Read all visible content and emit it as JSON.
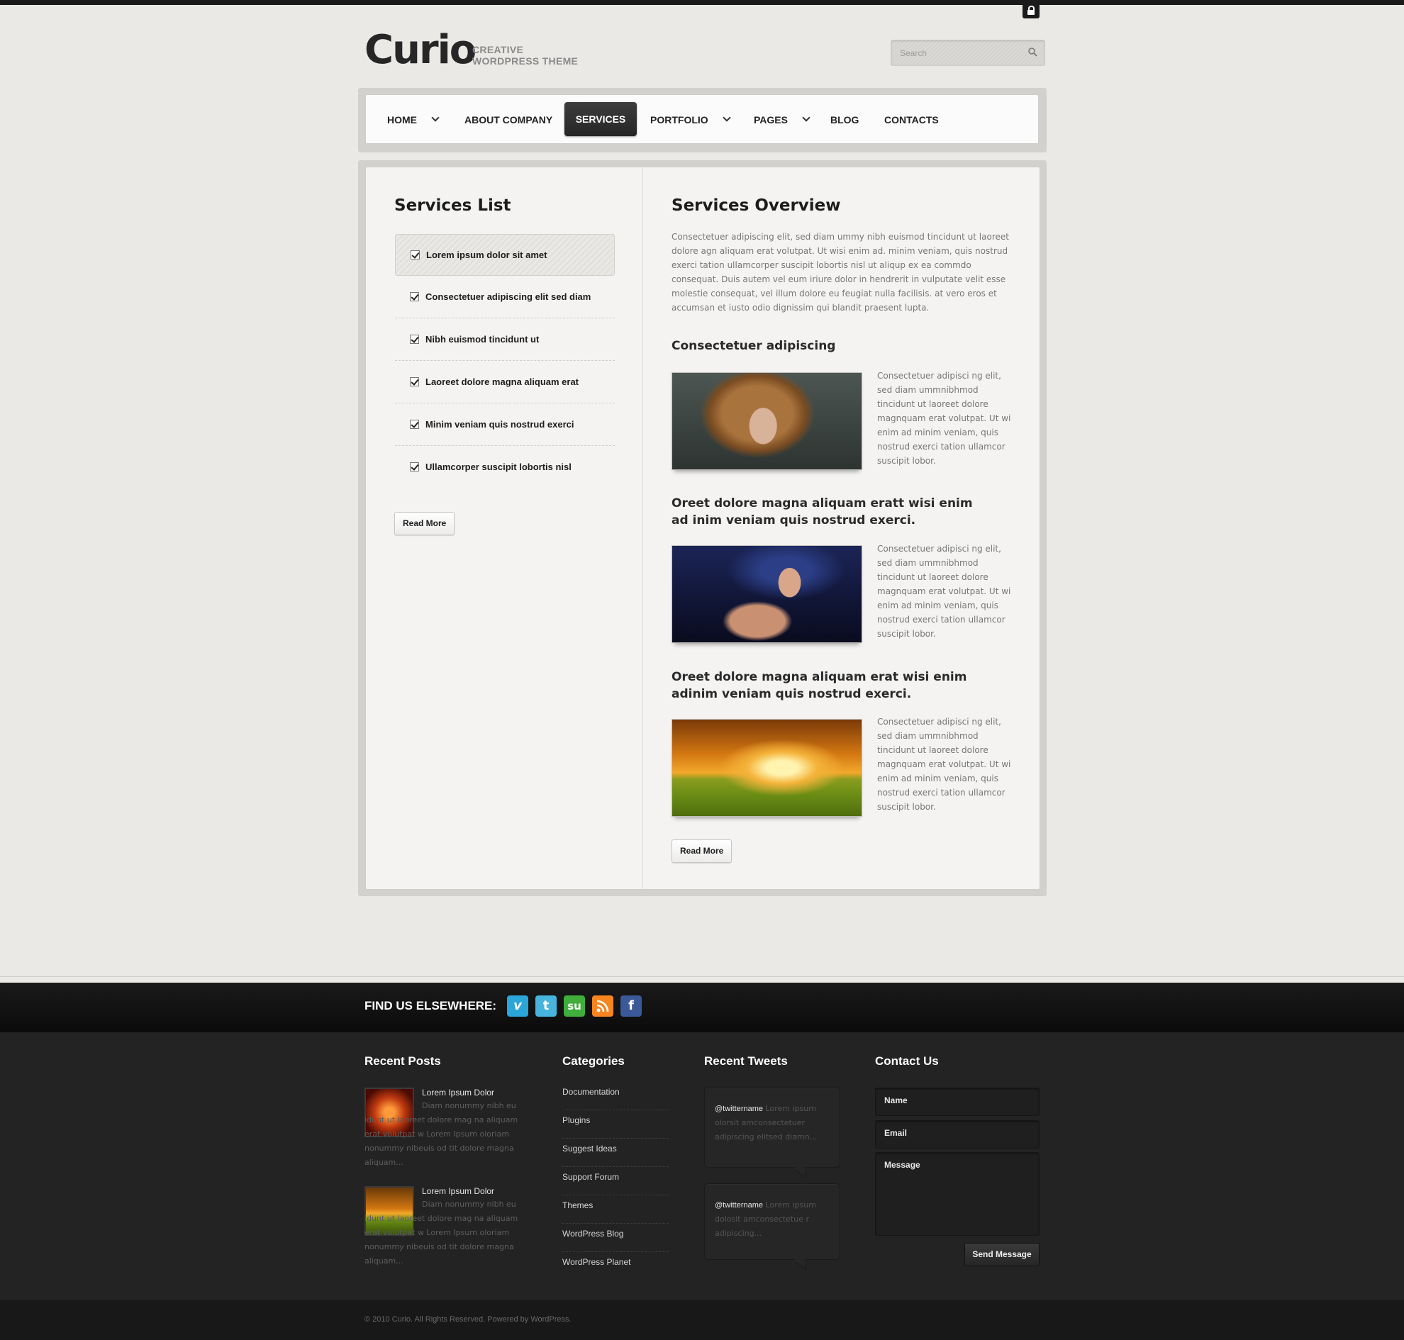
{
  "header": {
    "logo": "Curio",
    "tagline_line1": "CREATIVE",
    "tagline_line2": "WORDPRESS THEME",
    "search_placeholder": "Search"
  },
  "nav": {
    "items": [
      {
        "label": "HOME",
        "has_dropdown": true
      },
      {
        "label": "ABOUT COMPANY",
        "has_dropdown": false
      },
      {
        "label": "SERVICES",
        "has_dropdown": false,
        "active": true
      },
      {
        "label": "PORTFOLIO",
        "has_dropdown": true
      },
      {
        "label": "PAGES",
        "has_dropdown": true
      },
      {
        "label": "BLOG",
        "has_dropdown": false
      },
      {
        "label": "CONTACTS",
        "has_dropdown": false
      }
    ]
  },
  "services_list": {
    "title": "Services List",
    "items": [
      "Lorem ipsum dolor sit amet",
      "Consectetuer adipiscing elit sed diam",
      "Nibh euismod tincidunt ut",
      "Laoreet dolore magna aliquam erat",
      "Minim veniam quis nostrud exerci",
      "Ullamcorper suscipit lobortis nisl"
    ],
    "read_more": "Read More"
  },
  "overview": {
    "title": "Services Overview",
    "intro": "Consectetuer adipiscing elit, sed diam ummy nibh euismod tincidunt ut laoreet dolore agn aliquam erat volutpat. Ut wisi enim ad. minim veniam, quis nostrud exerci tation ullamcorper suscipit lobortis nisl ut aliqup ex ea commdo consequat. Duis autem vel eum iriure dolor in hendrerit in vulputate velit esse molestie consequat, vel illum dolore eu feugiat nulla facilisis. at vero eros et accumsan et iusto odio dignissim qui blandit praesent lupta.",
    "sections": [
      {
        "heading": "Consectetuer adipiscing",
        "text": "Consectetuer adipisci ng elit, sed diam ummnibhmod tincidunt ut laoreet dolore magnquam erat volutpat. Ut wi enim ad minim veniam, quis nostrud exerci tation ullamcor suscipit lobor."
      },
      {
        "heading": "Oreet dolore magna aliquam eratt wisi enim ad inim veniam quis nostrud exerci.",
        "text": "Consectetuer adipisci ng elit, sed diam ummnibhmod tincidunt ut laoreet dolore magnquam erat volutpat. Ut wi enim ad minim veniam, quis nostrud exerci tation ullamcor suscipit lobor."
      },
      {
        "heading": "Oreet dolore magna aliquam erat wisi enim adinim veniam quis nostrud exerci.",
        "text": "Consectetuer adipisci ng elit, sed diam ummnibhmod tincidunt ut laoreet dolore magnquam erat volutpat. Ut wi enim ad minim veniam, quis nostrud exerci tation ullamcor suscipit lobor."
      }
    ],
    "read_more": "Read More"
  },
  "footer": {
    "find_us": "FIND US ELSEWHERE:",
    "social_icons": [
      "vimeo-icon",
      "twitter-icon",
      "stumbleupon-icon",
      "rss-icon",
      "facebook-icon"
    ],
    "recent_posts": {
      "title": "Recent Posts",
      "posts": [
        {
          "title": "Lorem Ipsum Dolor",
          "text": "Diam nonummy nibh eu idunt ut laoreet dolore mag na aliquam erat volutpat w Lorem Ipsum oloriam nonummy nibeuis od tit dolore magna aliquam..."
        },
        {
          "title": "Lorem Ipsum Dolor",
          "text": "Diam nonummy nibh eu idunt ut laoreet dolore mag na aliquam erat volutpat w Lorem Ipsum oloriam nonummy nibeuis od tit dolore magna aliquam..."
        }
      ]
    },
    "categories": {
      "title": "Categories",
      "items": [
        "Documentation",
        "Plugins",
        "Suggest Ideas",
        "Support Forum",
        "Themes",
        "WordPress Blog",
        "WordPress Planet"
      ]
    },
    "recent_tweets": {
      "title": "Recent Tweets",
      "tweets": [
        {
          "handle": "@twittername",
          "text": "Lorem ipsum olorsit amconsectetuer adipiscing elitsed diamn..."
        },
        {
          "handle": "@twittername",
          "text": "Lorem ipsum dolosit amconsectetue r adipiscing..."
        }
      ]
    },
    "contact": {
      "title": "Contact Us",
      "name_label": "Name",
      "email_label": "Email",
      "message_label": "Message",
      "send_label": "Send Message"
    },
    "copyright": "© 2010 Curio. All Rights Reserved. Powered by WordPress."
  },
  "colors": {
    "page_bg": "#ebe9e6",
    "nav_active_bg": "#2f2f2f",
    "footer_bg": "#232323",
    "vimeo": "#2aa6d8",
    "twitter": "#46b4dc",
    "stumbleupon": "#3fae3b",
    "rss": "#f6841f",
    "facebook": "#3b5998"
  }
}
